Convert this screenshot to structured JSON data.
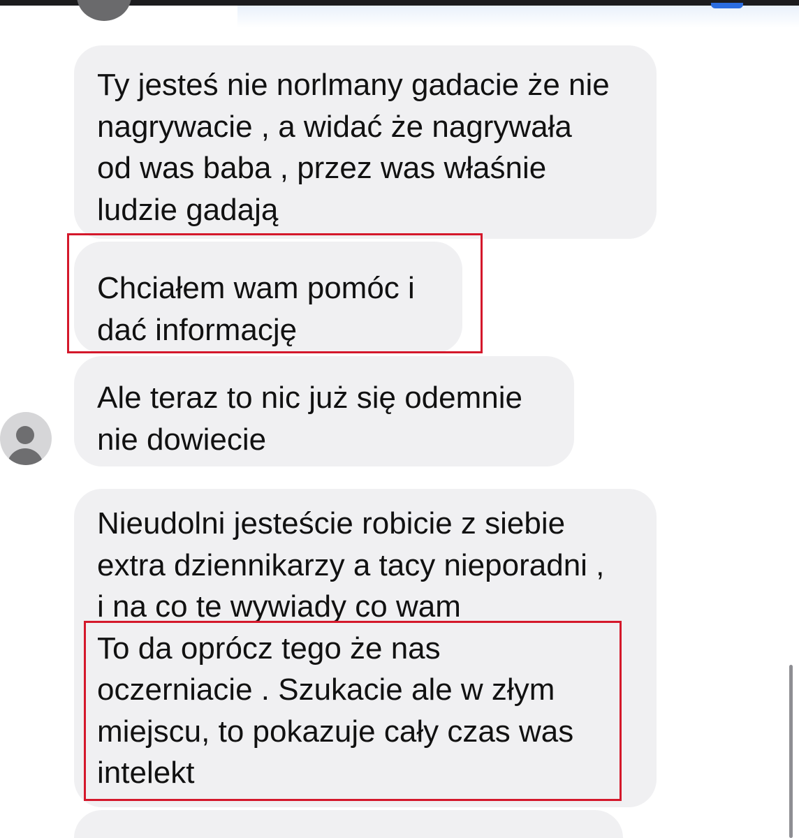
{
  "conversation": {
    "messages": [
      {
        "text": "Ty jesteś nie norlmany gadacie że nie\nnagrywacie , a widać że nagrywała\nod was baba , przez was właśnie\nludzie gadają"
      },
      {
        "text": "Chciałem wam pomóc i\ndać informację"
      },
      {
        "text": "Ale teraz to nic już się odemnie\nnie dowiecie"
      },
      {
        "text": "Nieudolni jesteście robicie z siebie\nextra dziennikarzy a tacy nieporadni ,\ni na co te wywiady co wam\nTo da oprócz tego że nas\noczerniacie . Szukacie ale w złym\nmiejscu, to pokazuje cały czas was\nintelekt"
      },
      {
        "text": ""
      }
    ]
  },
  "colors": {
    "bubble_background": "#f0f0f2",
    "text": "#111111",
    "highlight_border": "#d4182b",
    "page_background": "#ffffff",
    "top_accent": "#2b6de0"
  },
  "icons": {
    "contact_avatar": "avatar-icon",
    "top_avatar": "avatar-icon"
  }
}
